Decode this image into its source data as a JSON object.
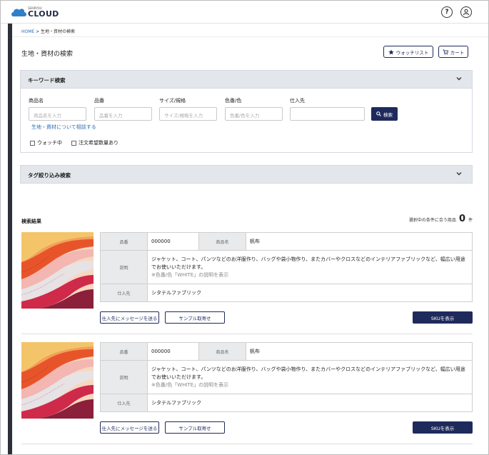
{
  "header": {
    "logo_sub": "SEKIRYOU",
    "logo_main": "CLOUD",
    "help_icon": "?",
    "user_icon": "user-circle-icon"
  },
  "breadcrumb": {
    "home": "HOME",
    "separator": " > ",
    "current": "生地・資材の検索"
  },
  "page": {
    "title": "生地・資材の検索",
    "watchlist_label": "ウォッチリスト",
    "cart_label": "カート"
  },
  "keyword_panel": {
    "title": "キーワード検索",
    "fields": [
      {
        "label": "商品名",
        "placeholder": "商品名を入力",
        "value": ""
      },
      {
        "label": "品番",
        "placeholder": "品番を入力",
        "value": ""
      },
      {
        "label": "サイズ/規格",
        "placeholder": "サイズ/規格を入力",
        "value": ""
      },
      {
        "label": "色番/色",
        "placeholder": "色番/色を入力",
        "value": ""
      },
      {
        "label": "仕入先",
        "placeholder": "",
        "value": ""
      }
    ],
    "search_label": "検索",
    "consult_link": "生地・資材について相談する",
    "checkbox_watching": "ウォッチ中",
    "checkbox_order": "注文希望数量あり"
  },
  "tag_panel": {
    "title": "タグ絞り込み検索"
  },
  "results": {
    "title": "検索結果",
    "count_label": "選択中の条件に合う商品",
    "count": "0",
    "count_unit": "件",
    "items": [
      {
        "code_label": "品番",
        "code": "000000",
        "name_label": "商品名",
        "name": "帆布",
        "desc_label": "説明",
        "desc": "ジャケット、コート、パンツなどのお洋服作り、バッグや袋小物作り、またカバーやクロスなどのインテリアファブリックなど、幅広い用途でお使いいただけます。",
        "desc_note": "※色番/色「WHITE」の説明を表示",
        "supplier_label": "仕入先",
        "supplier": "シタテルファブリック",
        "message_button": "仕入先にメッセージを送る",
        "sample_button": "サンプル取寄せ",
        "sku_button": "SKUを表示"
      },
      {
        "code_label": "品番",
        "code": "000000",
        "name_label": "商品名",
        "name": "帆布",
        "desc_label": "説明",
        "desc": "ジャケット、コート、パンツなどのお洋服作り、バッグや袋小物作り、またカバーやクロスなどのインテリアファブリックなど、幅広い用途でお使いいただけます。",
        "desc_note": "※色番/色「WHITE」の説明を表示",
        "supplier_label": "仕入先",
        "supplier": "シタテルファブリック",
        "message_button": "仕入先にメッセージを送る",
        "sample_button": "サンプル取寄せ",
        "sku_button": "SKUを表示"
      }
    ]
  },
  "colors": {
    "primary": "#1f2a5c",
    "link": "#2f6db5",
    "panel_head": "#e3e7ec",
    "rail": "#2e3038"
  }
}
